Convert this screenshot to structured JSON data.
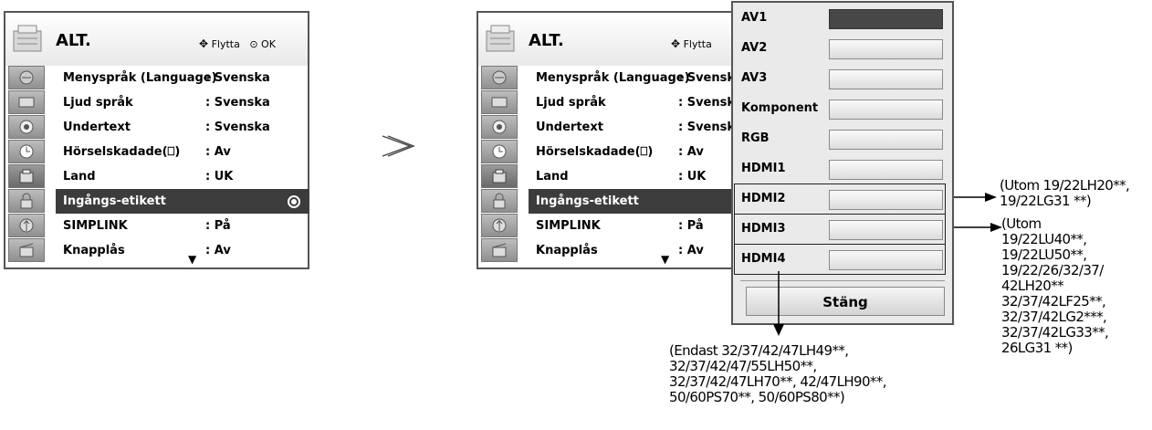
{
  "left_menu": {
    "title": "ALT.",
    "nav_move": "Flytta",
    "nav_ok": "OK",
    "items": [
      {
        "label": "Menyspråk (Language)",
        "value": ": Svenska"
      },
      {
        "label": "Ljud språk",
        "value": ": Svenska"
      },
      {
        "label": "Undertext",
        "value": ": Svenska"
      },
      {
        "label": "Hörselskadade(",
        "value": ": Av"
      },
      {
        "label": "Land",
        "value": ": UK"
      },
      {
        "label": "Ingångs-etikett",
        "value": ""
      },
      {
        "label": "SIMPLINK",
        "value": ": På"
      },
      {
        "label": "Knapplås",
        "value": ": Av"
      }
    ],
    "selected_item": "Ingångs-etikett"
  },
  "right_menu": {
    "title": "ALT.",
    "nav_move": "Flytta",
    "items": [
      {
        "label": "Menyspråk (Language)",
        "value": ": Svensk"
      },
      {
        "label": "Ljud språk",
        "value": ": Svenska"
      },
      {
        "label": "Undertext",
        "value": ": Svenska"
      },
      {
        "label": "Hörselskadade(",
        "value": ": Av"
      },
      {
        "label": "Land",
        "value": ": UK"
      },
      {
        "label": "Ingångs-etikett",
        "value": ""
      },
      {
        "label": "SIMPLINK",
        "value": ": På"
      },
      {
        "label": "Knapplås",
        "value": ": Av"
      }
    ]
  },
  "transition_arrow": "≫",
  "input_popup": {
    "inputs": [
      "AV1",
      "AV2",
      "AV3",
      "Komponent",
      "RGB",
      "HDMI1",
      "HDMI2",
      "HDMI3",
      "HDMI4"
    ],
    "close_label": "Stäng"
  },
  "notes": {
    "hdmi2": "(Utom 19/22LH20**,\n19/22LG31 **)",
    "hdmi3": "(Utom\n19/22LU40**,\n19/22LU50**,\n19/22/26/32/37/\n42LH20**\n32/37/42LF25**,\n32/37/42LG2***,\n32/37/42LG33**,\n26LG31 **)",
    "hdmi4": "(Endast 32/37/42/47LH49**,\n32/37/42/47/55LH50**,\n32/37/42/47LH70**, 42/47LH90**,\n50/60PS70**, 50/60PS80**)"
  },
  "colors": {
    "selected_row": "#3c3c3c",
    "menu_border": "#555555",
    "popup_bg": "#eaeaea",
    "selected_input_box": "#474747"
  }
}
